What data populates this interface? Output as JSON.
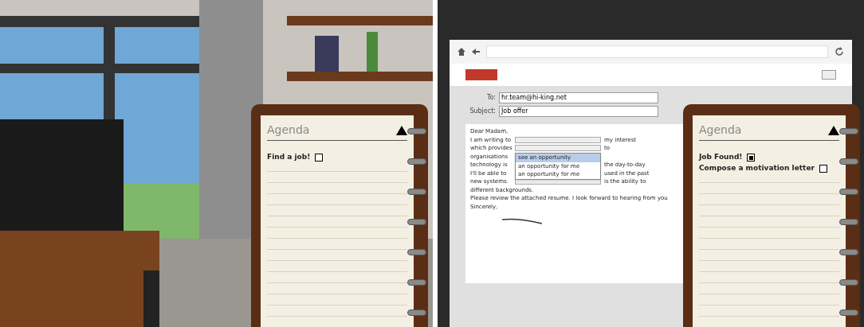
{
  "left_scene": {
    "kind": "picture",
    "agenda": {
      "title": "Agenda",
      "tasks": [
        {
          "label": "Find a job!",
          "checked": false
        }
      ]
    }
  },
  "right_scene": {
    "browser": {
      "fields": [
        {
          "label": "To:",
          "value": "hr.team@hi-king.net"
        },
        {
          "label": "Subject:",
          "value": "Job offer"
        }
      ],
      "letter": {
        "greeting": "Dear Madam,",
        "lines": [
          [
            "I am writing to",
            "my interest"
          ],
          [
            "which provides",
            "to"
          ],
          [
            "organisations"
          ],
          [
            "technology is",
            "the day-to-day"
          ],
          [
            "I'll be able to",
            "used in the past"
          ],
          [
            "new systems.",
            "is the ability to"
          ],
          [
            "different backgrounds."
          ]
        ],
        "dropdown_options": [
          {
            "label": "see an opportunity",
            "selected": true
          },
          {
            "label": "an opportunity for me",
            "selected": false
          },
          {
            "label": "an opportunity for me",
            "selected": false
          }
        ],
        "closing": "Please review the attached resume. I look forward to hearing from you",
        "signoff": "Sincerely,"
      }
    },
    "agenda": {
      "title": "Agenda",
      "tasks": [
        {
          "label": "Job Found!",
          "checked": true
        },
        {
          "label": "Compose a motivation letter",
          "checked": false
        }
      ]
    }
  }
}
